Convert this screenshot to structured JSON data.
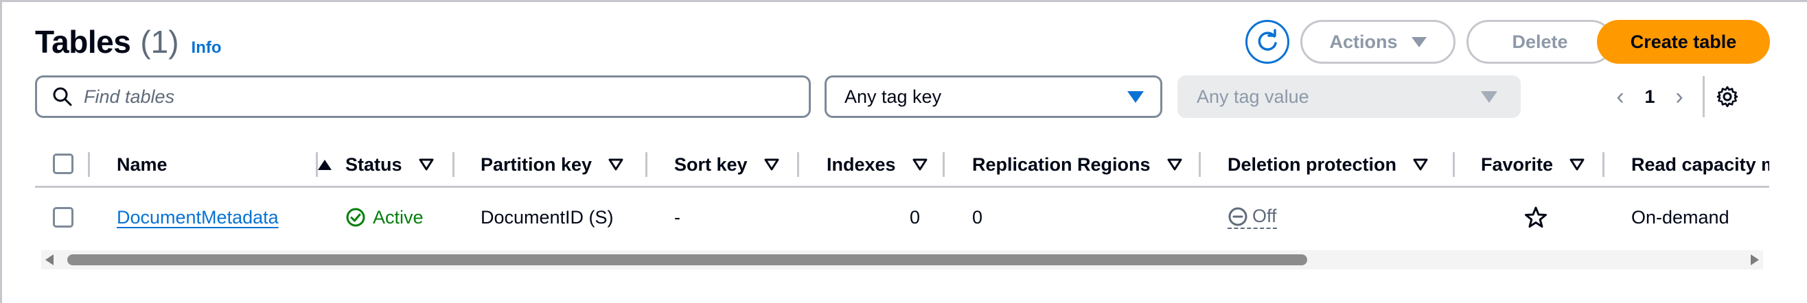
{
  "header": {
    "title": "Tables",
    "count": "(1)",
    "info_link": "Info",
    "actions_label": "Actions",
    "delete_label": "Delete",
    "create_label": "Create table"
  },
  "filters": {
    "search_placeholder": "Find tables",
    "tag_key": "Any tag key",
    "tag_value": "Any tag value"
  },
  "pagination": {
    "current_page": "1"
  },
  "table": {
    "columns": [
      {
        "label": "Name"
      },
      {
        "label": "Status"
      },
      {
        "label": "Partition key"
      },
      {
        "label": "Sort key"
      },
      {
        "label": "Indexes"
      },
      {
        "label": "Replication Regions"
      },
      {
        "label": "Deletion protection"
      },
      {
        "label": "Favorite"
      },
      {
        "label": "Read capacity m"
      }
    ],
    "rows": [
      {
        "name": "DocumentMetadata",
        "status": "Active",
        "partition_key": "DocumentID (S)",
        "sort_key": "-",
        "indexes": "0",
        "replication_regions": "0",
        "deletion_protection": "Off",
        "read_capacity": "On-demand"
      }
    ]
  },
  "colors": {
    "primary_orange": "#ff9900",
    "link_blue": "#0972d3",
    "status_green": "#037f0c"
  },
  "icons": {
    "refresh": "refresh-icon",
    "search": "search-icon",
    "settings": "gear-icon",
    "favorite": "star-icon",
    "status": "check-circle-icon",
    "deletion_off": "minus-circle-icon"
  }
}
